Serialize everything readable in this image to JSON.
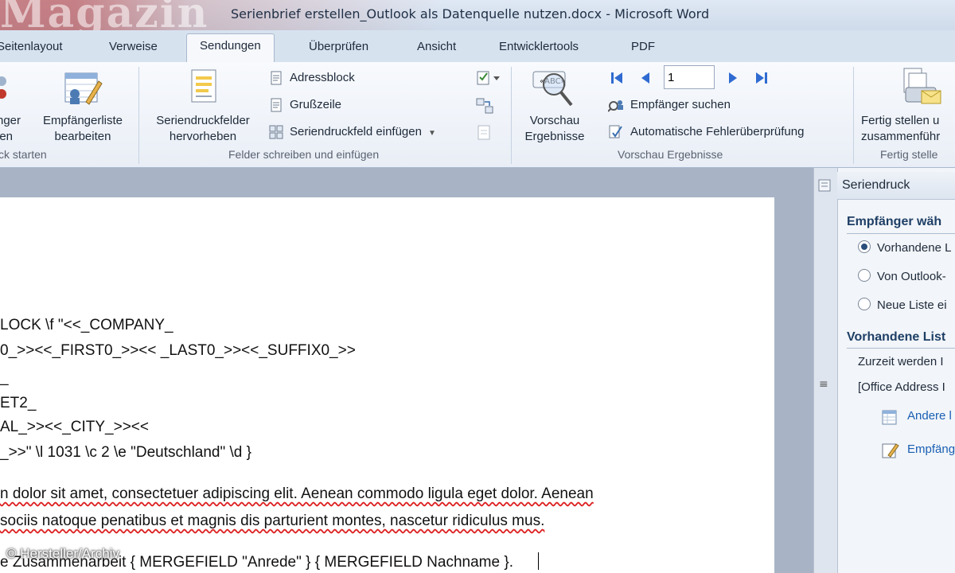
{
  "window": {
    "title": "Serienbrief erstellen_Outlook als Datenquelle nutzen.docx  -  Microsoft Word"
  },
  "watermark": {
    "logo_text": "Magazin"
  },
  "tabs": [
    {
      "label": "Seitenlayout"
    },
    {
      "label": "Verweise"
    },
    {
      "label": "Sendungen",
      "active": true
    },
    {
      "label": "Überprüfen"
    },
    {
      "label": "Ansicht"
    },
    {
      "label": "Entwicklertools"
    },
    {
      "label": "PDF"
    }
  ],
  "ribbon": {
    "start_group": {
      "label": "ck starten",
      "cut_button": "nger\nlen",
      "recipients_button": "Empfängerliste\nbearbeiten"
    },
    "fields_group": {
      "label": "Felder schreiben und einfügen",
      "highlight_button": "Seriendruckfelder\nhervorheben",
      "address_block": "Adressblock",
      "greeting": "Grußzeile",
      "insert_field": "Seriendruckfeld einfügen"
    },
    "preview_group": {
      "label": "Vorschau Ergebnisse",
      "preview_button": "Vorschau\nErgebnisse",
      "record_number": "1",
      "find_recipient": "Empfänger suchen",
      "auto_check": "Automatische Fehlerüberprüfung"
    },
    "finish_group": {
      "label": "Fertig stelle",
      "finish_button": "Fertig stellen u\nzusammenführ"
    }
  },
  "document": {
    "lines": [
      "LOCK \\f \"<<_COMPANY_",
      "0_>><<_FIRST0_>><< _LAST0_>><<_SUFFIX0_>>",
      "_",
      "ET2_",
      "AL_>><<_CITY_>><<",
      "_>>\" \\l 1031 \\c 2 \\e \"Deutschland\" \\d }",
      "n dolor sit amet, consectetuer adipiscing elit. Aenean commodo ligula eget dolor. Aenean",
      " sociis natoque penatibus et magnis dis parturient montes, nascetur ridiculus mus.",
      "e Zusammenarbeit { MERGEFIELD \"Anrede\" } { MERGEFIELD Nachname }."
    ]
  },
  "task_pane": {
    "title": "Seriendruck",
    "section1_heading": "Empfänger wäh",
    "options": [
      {
        "label": "Vorhandene L",
        "selected": true
      },
      {
        "label": "Von Outlook-",
        "selected": false
      },
      {
        "label": "Neue Liste ei",
        "selected": false
      }
    ],
    "section2_heading": "Vorhandene List",
    "info_line1": "Zurzeit werden I",
    "info_line2": "[Office Address I",
    "link1": "Andere l",
    "link2": "Empfäng"
  },
  "footer": {
    "copyright": "© Hersteller/Archiv"
  },
  "colors": {
    "accent": "#1e3f66",
    "link": "#1a5fb4",
    "ribbon_bg": "#eef2f8"
  }
}
